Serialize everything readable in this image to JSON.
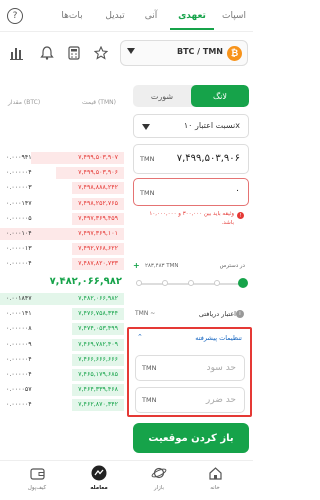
{
  "tabs": [
    {
      "label": "اسپات"
    },
    {
      "label": "تعهدی"
    },
    {
      "label": "آنی"
    },
    {
      "label": "تبدیل"
    },
    {
      "label": "بات‌ها"
    }
  ],
  "pair": {
    "label": "BTC / TMN"
  },
  "orderbook": {
    "price_header": "قیمت (TMN)",
    "amount_header": "مقدار (BTC)",
    "asks": [
      {
        "price": "۷,۴۹۹,۵۰۳,۹۰۷",
        "amount": "۰.۰۰۰۹۴۱",
        "depth": 0.75
      },
      {
        "price": "۷,۴۹۹,۵۰۳,۹۰۶",
        "amount": "۰.۰۰۰۰۰۴",
        "depth": 0.55
      },
      {
        "price": "۷,۴۹۸,۸۸۸,۲۴۲",
        "amount": "۰.۰۰۰۰۰۳",
        "depth": 0.42
      },
      {
        "price": "۷,۴۹۸,۲۵۲,۷۶۵",
        "amount": "۰.۰۰۰۱۴۷",
        "depth": 0.42
      },
      {
        "price": "۷,۴۹۷,۳۶۹,۴۵۹",
        "amount": "۰.۰۰۰۰۰۵",
        "depth": 0.42
      },
      {
        "price": "۷,۴۹۷,۳۶۹,۱۰۱",
        "amount": "۰.۰۰۰۱۰۴",
        "depth": 1.0
      },
      {
        "price": "۷,۴۹۲,۷۶۸,۶۲۲",
        "amount": "۰.۰۰۰۰۱۳",
        "depth": 0.42
      },
      {
        "price": "۷,۴۸۷,۸۲۰,۷۳۳",
        "amount": "۰.۰۰۰۰۰۴",
        "depth": 0.42
      }
    ],
    "mid_price": "۷,۴۸۲,۰۶۶,۹۸۲",
    "bids": [
      {
        "price": "۷,۴۸۲,۰۶۶,۹۸۲",
        "amount": "۰.۰۰۱۸۴۷",
        "depth": 1.0
      },
      {
        "price": "۷,۴۷۶,۷۵۸,۳۴۴",
        "amount": "۰.۰۰۰۱۴۱",
        "depth": 0.42
      },
      {
        "price": "۷,۴۷۴,۰۵۳,۴۹۹",
        "amount": "۰.۰۰۰۰۰۸",
        "depth": 0.42
      },
      {
        "price": "۷,۴۶۹,۷۸۲,۴۰۹",
        "amount": "۰.۰۰۰۰۰۹",
        "depth": 0.42
      },
      {
        "price": "۷,۴۶۶,۶۶۶,۶۶۶",
        "amount": "۰.۰۰۰۰۰۴",
        "depth": 0.42
      },
      {
        "price": "۷,۴۶۵,۱۷۹,۶۸۵",
        "amount": "۰.۰۰۰۰۰۴",
        "depth": 0.42
      },
      {
        "price": "۷,۴۶۴,۳۳۹,۴۶۸",
        "amount": "۰.۰۰۰۰۵۷",
        "depth": 0.42
      },
      {
        "price": "۷,۴۶۲,۸۷۰,۳۴۲",
        "amount": "۰.۰۰۰۰۰۴",
        "depth": 0.42
      }
    ]
  },
  "form": {
    "buy_label": "لانگ",
    "sell_label": "شورت",
    "leverage_label": "نسبت اعتبار ۱۰x",
    "price_value": "۷,۴۹۹,۵۰۳,۹۰۶",
    "price_unit": "TMN",
    "amount_value": "۰",
    "amount_unit": "TMN",
    "error_text": "وثیقه باید بین ۳۰۰,۰۰۰ و ۱۰,۰۰۰,۰۰۰ باشد.",
    "available_label": "در دسترس",
    "available_value": "۲۸۳,۴۸۳ TMN",
    "credit_label": "اعتبار دریافتی",
    "credit_value": "TMN ~",
    "advanced_label": "تنظیمات پیشرفته",
    "take_profit_placeholder": "حد سود",
    "stop_loss_placeholder": "حد ضرر",
    "tp_unit": "TMN",
    "sl_unit": "TMN",
    "submit_label": "باز کردن موقعیت",
    "slider_fraction": 1.0
  },
  "nav": [
    {
      "label": "خانه",
      "icon": "home-icon"
    },
    {
      "label": "بازار",
      "icon": "planet-icon"
    },
    {
      "label": "معامله",
      "icon": "trade-icon"
    },
    {
      "label": "کیف‌پول",
      "icon": "wallet-icon"
    }
  ],
  "colors": {
    "accent": "#16a34a",
    "ask": "#e53935",
    "error": "#e53935",
    "link": "#1565c0"
  }
}
